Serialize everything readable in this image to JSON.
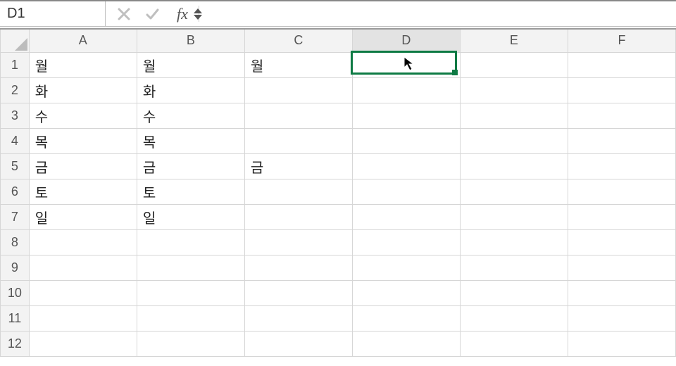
{
  "formula_bar": {
    "name_box_value": "D1",
    "cancel_tip": "Cancel",
    "enter_tip": "Enter",
    "fx_label": "fx",
    "formula_value": ""
  },
  "columns": [
    "A",
    "B",
    "C",
    "D",
    "E",
    "F"
  ],
  "selected_column": "D",
  "row_headers": [
    "1",
    "2",
    "3",
    "4",
    "5",
    "6",
    "7",
    "8",
    "9",
    "10",
    "11",
    "12"
  ],
  "selected_cell": "D1",
  "cells": {
    "A1": "월",
    "B1": "월",
    "C1": "월",
    "A2": "화",
    "B2": "화",
    "A3": "수",
    "B3": "수",
    "A4": "목",
    "B4": "목",
    "A5": "금",
    "B5": "금",
    "C5": "금",
    "A6": "토",
    "B6": "토",
    "A7": "일",
    "B7": "일"
  },
  "chart_data": {
    "type": "table",
    "columns": [
      "A",
      "B",
      "C",
      "D",
      "E",
      "F"
    ],
    "rows": [
      [
        "월",
        "월",
        "월",
        "",
        "",
        ""
      ],
      [
        "화",
        "화",
        "",
        "",
        "",
        ""
      ],
      [
        "수",
        "수",
        "",
        "",
        "",
        ""
      ],
      [
        "목",
        "목",
        "",
        "",
        "",
        ""
      ],
      [
        "금",
        "금",
        "금",
        "",
        "",
        ""
      ],
      [
        "토",
        "토",
        "",
        "",
        "",
        ""
      ],
      [
        "일",
        "일",
        "",
        "",
        "",
        ""
      ],
      [
        "",
        "",
        "",
        "",
        "",
        ""
      ],
      [
        "",
        "",
        "",
        "",
        "",
        ""
      ],
      [
        "",
        "",
        "",
        "",
        "",
        ""
      ],
      [
        "",
        "",
        "",
        "",
        "",
        ""
      ],
      [
        "",
        "",
        "",
        "",
        "",
        ""
      ]
    ]
  }
}
